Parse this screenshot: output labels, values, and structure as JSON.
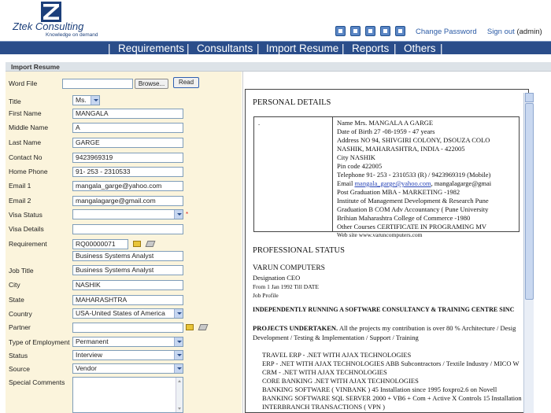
{
  "header": {
    "logo": {
      "name": "Ztek Consulting",
      "tagline": "Knowledge on demand"
    },
    "icons": [
      "print-icon",
      "calendar-icon",
      "clock-icon",
      "grid-icon",
      "notes-icon"
    ],
    "change_password": "Change Password",
    "sign_out": "Sign out",
    "user": "(admin)"
  },
  "nav": {
    "sep": "|",
    "items": [
      "Requirements",
      "Consultants",
      "Import Resume",
      "Reports",
      "Others"
    ]
  },
  "panel_title": "Import Resume",
  "word_file": {
    "label": "Word File",
    "value": "",
    "browse": "Browse...",
    "read": "Read"
  },
  "form": {
    "title": {
      "label": "Title",
      "value": "Ms."
    },
    "first_name": {
      "label": "First Name",
      "value": "MANGALA"
    },
    "middle_name": {
      "label": "Middle Name",
      "value": "A"
    },
    "last_name": {
      "label": "Last Name",
      "value": "GARGE"
    },
    "contact_no": {
      "label": "Contact No",
      "value": "9423969319"
    },
    "home_phone": {
      "label": "Home Phone",
      "value": "91- 253 - 2310533"
    },
    "email1": {
      "label": "Email 1",
      "value": "mangala_garge@yahoo.com"
    },
    "email2": {
      "label": "Email 2",
      "value": "mangalagarge@gmail.com"
    },
    "visa_status": {
      "label": "Visa Status",
      "value": "",
      "required": "*"
    },
    "visa_details": {
      "label": "Visa Details",
      "value": ""
    },
    "requirement": {
      "label": "Requirement",
      "value": "RQ00000071",
      "sub_value": "Business Systems Analyst"
    },
    "job_title": {
      "label": "Job Title",
      "value": "Business Systems Analyst"
    },
    "city": {
      "label": "City",
      "value": "NASHIK"
    },
    "state": {
      "label": "State",
      "value": "MAHARASHTRA"
    },
    "country": {
      "label": "Country",
      "value": "USA-United States of America"
    },
    "partner": {
      "label": "Partner",
      "value": ""
    },
    "employment": {
      "label": "Type of Employment",
      "value": "Permanent"
    },
    "status": {
      "label": "Status",
      "value": "Interview"
    },
    "source": {
      "label": "Source",
      "value": "Vendor"
    },
    "comments": {
      "label": "Special Comments",
      "value": ""
    }
  },
  "resume": {
    "personal_heading": "PERSONAL DETAILS",
    "bullet": ".",
    "details": [
      "Name Mrs. MANGALA A GARGE",
      "Date of Birth 27 -08-1959 - 47 years",
      "Address NO 94, SHIVGIRI COLONY, DSOUZA COLO",
      "NASHIK, MAHARASHTRA, INDIA - 422005",
      "City NASHIK",
      "Pin code 422005",
      "Telephone 91- 253 - 2310533 (R) / 9423969319 (Mobile)",
      "Post Graduation MBA - MARKETING -1982",
      "Institute of Management Development & Research Pune",
      "Graduation B COM Adv Accountancy ( Pune University",
      "Brihian Maharashtra College of Commerce -1980",
      "Other Courses CERTIFICATE IN PROGRAMING MV",
      "Web site www.varuncomputers.com"
    ],
    "email_line": {
      "prefix": "Email ",
      "link": "mangala_garge@yahoo.com",
      "rest": ", mangalagarge@gmai"
    },
    "professional_heading": "PROFESSIONAL STATUS",
    "company": "VARUN COMPUTERS",
    "designation": "Designation CEO",
    "period": "From 1 Jan 1992 Till DATE",
    "job_profile": "Job Profile",
    "running": "INDEPENDENTLY RUNNING A SOFTWARE CONSULTANCY & TRAINING CENTRE SINC",
    "projects_bold": "PROJECTS UNDERTAKEN.",
    "projects_text": " All the projects my contribution is over 80 % Architecture / Desig",
    "projects_text2": "Development / Testing & Implementation / Support / Training",
    "project_lines": [
      "TRAVEL ERP - .NET WITH AJAX TECHNOLOGIES",
      "ERP - .NET WITH AJAX TECHNOLOGIES ABB Subcontractors / Textile Industry / MICO W",
      "CRM - .NET WITH AJAX TECHNOLOGIES",
      "CORE BANKING .NET WITH AJAX TECHNOLOGIES",
      "BANKING SOFTWARE ( VINBANK ) 45 Installation since 1995 foxpro2.6 on Novell",
      "BANKING SOFTWARE SQL SERVER 2000 + VB6 + Com + Active X Controls 15 Installation",
      "INTERBRANCH TRANSACTIONS ( VPN )"
    ]
  }
}
